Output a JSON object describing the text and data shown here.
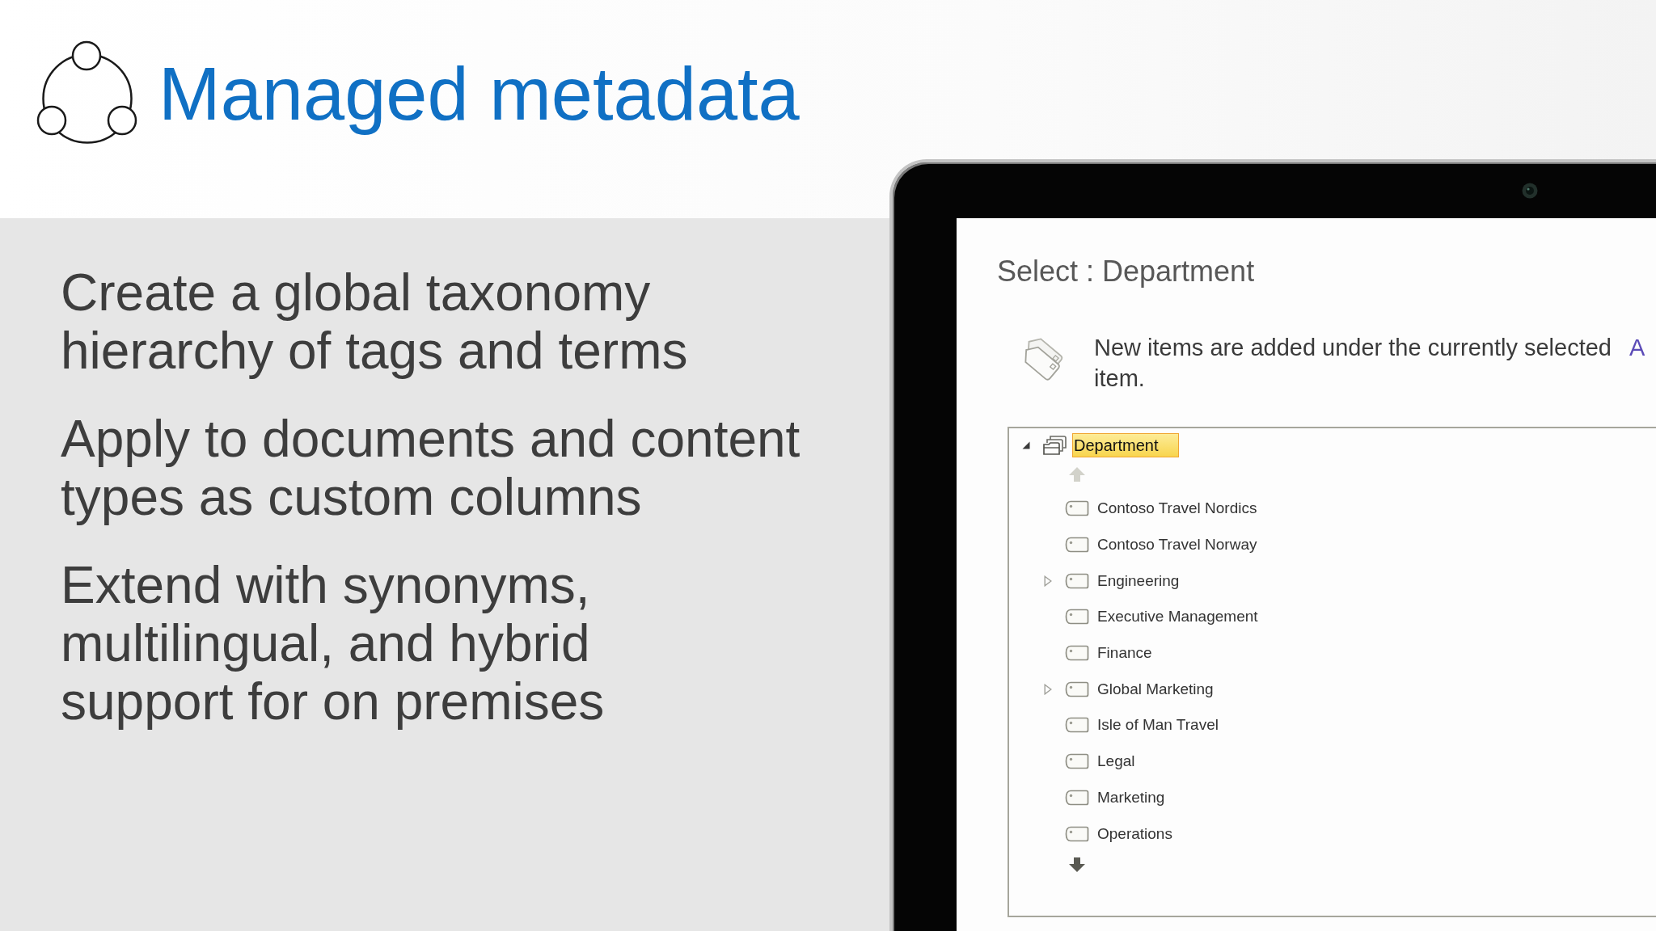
{
  "slide": {
    "title": "Managed metadata",
    "points": [
      {
        "lines": [
          "Create a global taxonomy",
          "hierarchy of tags and terms"
        ]
      },
      {
        "lines": [
          "Apply to documents and content",
          "types as custom columns"
        ]
      },
      {
        "lines": [
          "Extend with synonyms,",
          "multilingual, and hybrid",
          "support for on premises"
        ]
      }
    ]
  },
  "dialog": {
    "title": "Select : Department",
    "info": {
      "text": "New items are added under the currently selected",
      "link": "A",
      "text_after": "item."
    },
    "tree": {
      "root": {
        "label": "Department",
        "expanded": true,
        "selected": true,
        "children": [
          {
            "label": "Contoso Travel Nordics",
            "expandable": false,
            "expanded": false,
            "selected": false
          },
          {
            "label": "Contoso Travel Norway",
            "expandable": false,
            "expanded": false,
            "selected": false
          },
          {
            "label": "Engineering",
            "expandable": true,
            "expanded": false,
            "selected": false
          },
          {
            "label": "Executive Management",
            "expandable": false,
            "expanded": false,
            "selected": false
          },
          {
            "label": "Finance",
            "expandable": false,
            "expanded": false,
            "selected": false
          },
          {
            "label": "Global Marketing",
            "expandable": true,
            "expanded": false,
            "selected": false
          },
          {
            "label": "Isle of Man Travel",
            "expandable": false,
            "expanded": false,
            "selected": false
          },
          {
            "label": "Legal",
            "expandable": false,
            "expanded": false,
            "selected": false
          },
          {
            "label": "Marketing",
            "expandable": false,
            "expanded": false,
            "selected": false
          },
          {
            "label": "Operations",
            "expandable": false,
            "expanded": false,
            "selected": false
          }
        ]
      },
      "scroll_up": {
        "disabled": true
      },
      "scroll_down": {
        "disabled": false
      }
    }
  }
}
